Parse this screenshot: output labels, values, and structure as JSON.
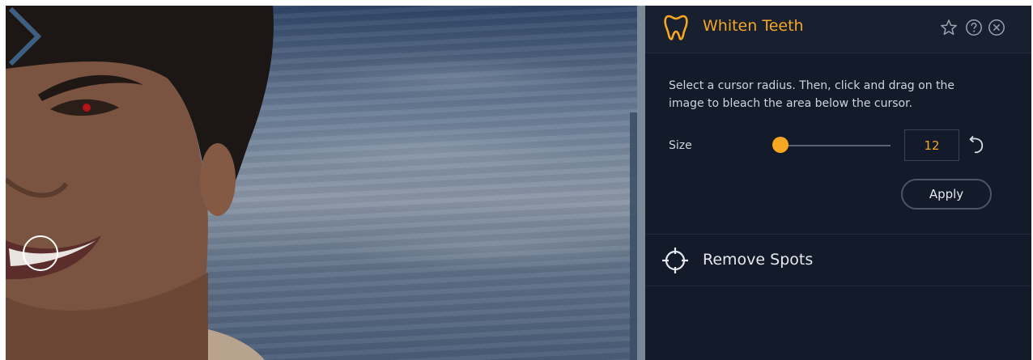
{
  "panel": {
    "title": "Whiten Teeth",
    "description": "Select a cursor radius. Then, click and drag on the image to bleach the area below the cursor.",
    "size_label": "Size",
    "size_value": "12",
    "size_slider_fraction": 0.0,
    "apply_label": "Apply",
    "header_icons": [
      "star-icon",
      "help-icon",
      "close-icon"
    ]
  },
  "tools": [
    {
      "label": "Remove Spots",
      "icon": "crosshair-icon"
    }
  ],
  "colors": {
    "accent": "#f5a623",
    "panel_bg": "#131a29",
    "header_bg": "#18202f",
    "text": "#e6e8ee"
  }
}
